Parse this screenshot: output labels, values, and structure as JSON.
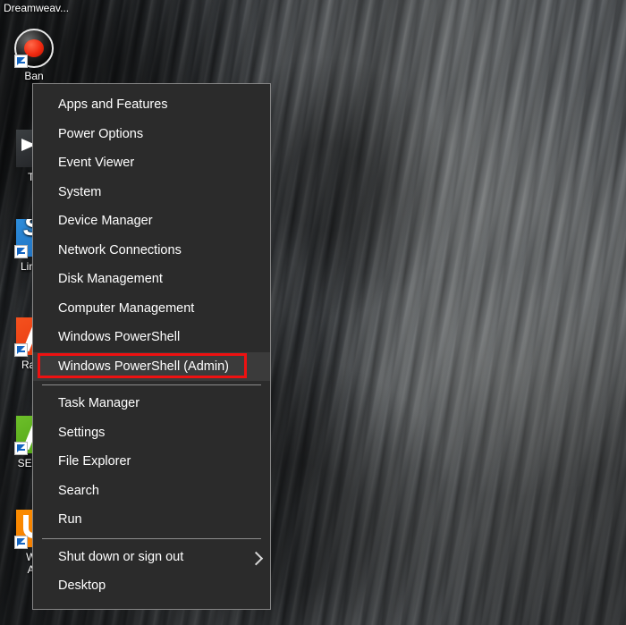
{
  "desktop": {
    "wallpaper_description": "dark striated rock cliff face",
    "partial_top_label": "Dreamweav...",
    "icons": [
      {
        "label": "Ban",
        "icon_name": "bandicam-round-icon",
        "shortcut": true
      },
      {
        "label": "Th",
        "icon_name": "thunderbird-dark-icon",
        "shortcut": false
      },
      {
        "label": "LinkA",
        "icon_name": "linkassistant-blue-icon",
        "shortcut": true
      },
      {
        "label": "Rank",
        "icon_name": "ranktracker-orange-icon",
        "shortcut": true
      },
      {
        "label": "SEO S",
        "icon_name": "seospyglass-green-icon",
        "shortcut": true
      },
      {
        "label": "We\nAu",
        "icon_name": "websiteauditor-orange-icon",
        "shortcut": true
      }
    ]
  },
  "winx_menu": {
    "name": "win-x-power-user-menu",
    "items": [
      {
        "label": "Apps and Features",
        "type": "item"
      },
      {
        "label": "Power Options",
        "type": "item"
      },
      {
        "label": "Event Viewer",
        "type": "item"
      },
      {
        "label": "System",
        "type": "item"
      },
      {
        "label": "Device Manager",
        "type": "item"
      },
      {
        "label": "Network Connections",
        "type": "item"
      },
      {
        "label": "Disk Management",
        "type": "item"
      },
      {
        "label": "Computer Management",
        "type": "item"
      },
      {
        "label": "Windows PowerShell",
        "type": "item"
      },
      {
        "label": "Windows PowerShell (Admin)",
        "type": "item",
        "hovered": true,
        "annotated": true
      },
      {
        "type": "separator"
      },
      {
        "label": "Task Manager",
        "type": "item"
      },
      {
        "label": "Settings",
        "type": "item"
      },
      {
        "label": "File Explorer",
        "type": "item"
      },
      {
        "label": "Search",
        "type": "item"
      },
      {
        "label": "Run",
        "type": "item"
      },
      {
        "type": "separator"
      },
      {
        "label": "Shut down or sign out",
        "type": "item",
        "submenu": true
      },
      {
        "label": "Desktop",
        "type": "item"
      }
    ]
  },
  "annotation": {
    "name": "red-highlight-rectangle",
    "color": "#ee1111",
    "target_label": "Windows PowerShell (Admin)"
  },
  "colors": {
    "menu_background": "#2b2b2b",
    "menu_border": "#868686",
    "menu_hover": "#3b3b3b",
    "menu_text": "#ffffff",
    "separator": "#8d8d8d",
    "annotation_red": "#ee1111"
  }
}
